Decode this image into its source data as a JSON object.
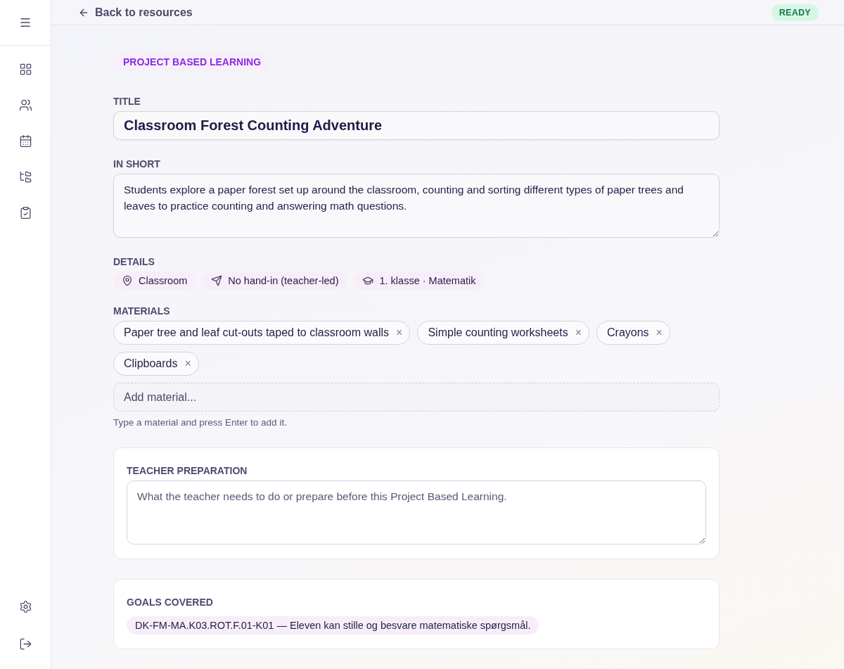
{
  "header": {
    "back_link": "Back to resources",
    "status": "READY"
  },
  "category": "PROJECT BASED LEARNING",
  "title_field": {
    "label": "TITLE",
    "value": "Classroom Forest Counting Adventure"
  },
  "in_short": {
    "label": "IN SHORT",
    "value": "Students explore a paper forest set up around the classroom, counting and sorting different types of paper trees and leaves to practice counting and answering math questions."
  },
  "details": {
    "label": "DETAILS",
    "items": [
      {
        "kind": "location",
        "text": "Classroom"
      },
      {
        "kind": "submission",
        "text": "No hand-in (teacher-led)"
      },
      {
        "kind": "grade",
        "text": "1. klasse · Matematik"
      }
    ]
  },
  "materials": {
    "label": "MATERIALS",
    "items": [
      "Paper tree and leaf cut-outs taped to classroom walls",
      "Simple counting worksheets",
      "Crayons",
      "Clipboards"
    ],
    "remove_mark": "×",
    "placeholder": "Add material...",
    "hint": "Type a material and press Enter to add it."
  },
  "teacher_preparation": {
    "label": "TEACHER PREPARATION",
    "placeholder": "What the teacher needs to do or prepare before this Project Based Learning."
  },
  "goals": {
    "label": "GOALS COVERED",
    "items": [
      "DK-FM-MA.K03.ROT.F.01-K01 — Eleven kan stille og besvare matematiske spørgsmål."
    ]
  }
}
